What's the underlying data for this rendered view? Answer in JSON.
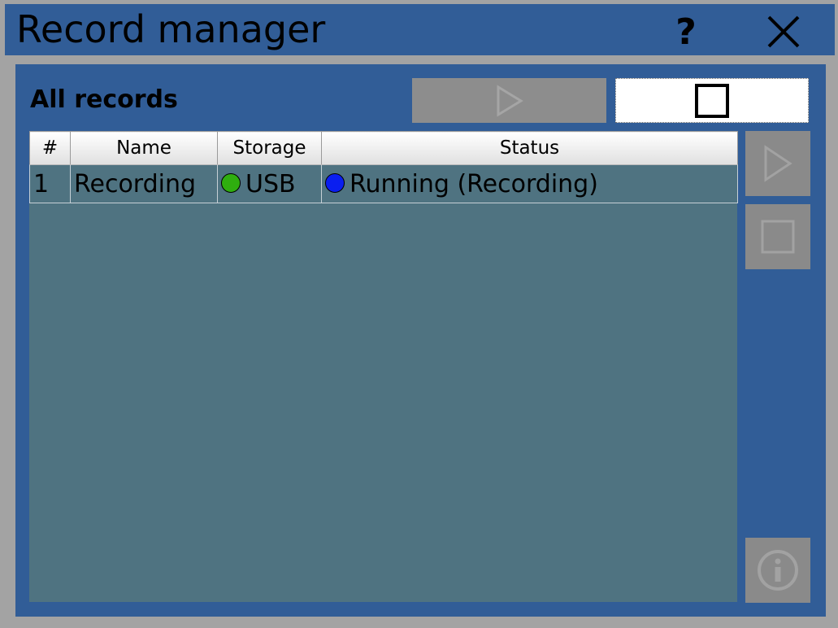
{
  "window": {
    "title": "Record manager",
    "help_label": "?",
    "close_icon": "close-icon"
  },
  "main": {
    "section_title": "All records",
    "toolbar": {
      "play_all_icon": "play-icon",
      "stop_all_icon": "stop-icon"
    },
    "table": {
      "columns": [
        "#",
        "Name",
        "Storage",
        "Status"
      ],
      "rows": [
        {
          "num": "1",
          "name": "Recording",
          "storage": "USB",
          "storage_color": "#2fae0f",
          "status": "Running (Recording)",
          "status_color": "#0a1ef0"
        }
      ]
    },
    "side_buttons": [
      "play-icon",
      "stop-icon",
      "info-icon"
    ]
  },
  "colors": {
    "titlebar": "#315d97",
    "panel": "#315d97",
    "frame": "#a3a3a3",
    "table_bg": "#4f7381",
    "disabled_button": "#8a8a8a"
  }
}
